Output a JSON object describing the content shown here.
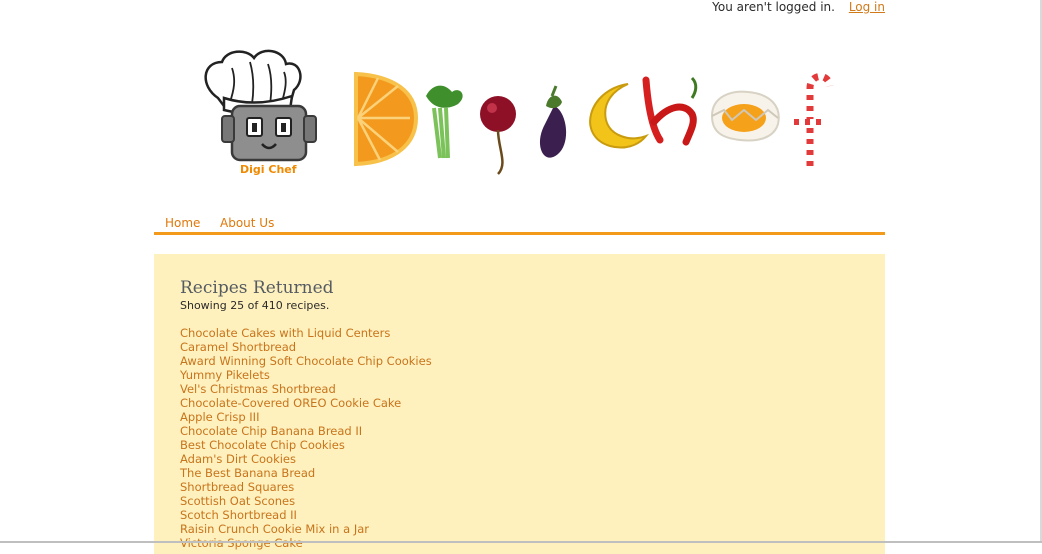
{
  "header": {
    "login_status": "You aren't logged in.",
    "login_link": "Log in"
  },
  "logo": {
    "robot_caption": "Digi Chef",
    "wordmark_alt": "DigiChef"
  },
  "nav": {
    "items": [
      {
        "label": "Home"
      },
      {
        "label": "About Us"
      }
    ],
    "accent_color": "#f39a1a"
  },
  "main": {
    "heading": "Recipes Returned",
    "summary": "Showing 25 of 410 recipes.",
    "recipes": [
      "Chocolate Cakes with Liquid Centers",
      "Caramel Shortbread",
      "Award Winning Soft Chocolate Chip Cookies",
      "Yummy Pikelets",
      "Vel's Christmas Shortbread",
      "Chocolate-Covered OREO Cookie Cake",
      "Apple Crisp III",
      "Chocolate Chip Banana Bread II",
      "Best Chocolate Chip Cookies",
      "Adam's Dirt Cookies",
      "The Best Banana Bread",
      "Shortbread Squares",
      "Scottish Oat Scones",
      "Scotch Shortbread II",
      "Raisin Crunch Cookie Mix in a Jar",
      "Victoria Sponge Cake"
    ]
  },
  "colors": {
    "panel_background": "#fff1bd",
    "link": "#c8741c"
  }
}
